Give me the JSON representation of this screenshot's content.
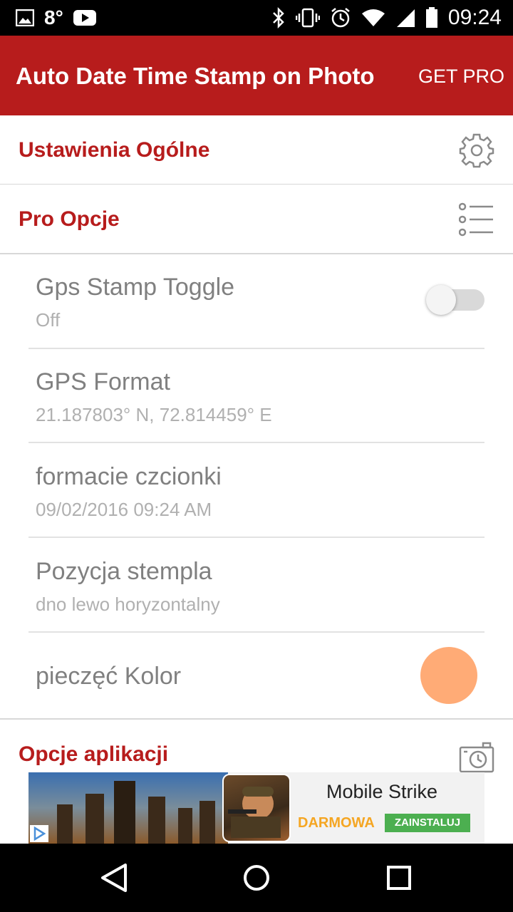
{
  "status_bar": {
    "temperature": "8°",
    "time": "09:24",
    "left_icons": [
      "image-icon",
      "youtube-icon"
    ],
    "right_icons": [
      "bluetooth-icon",
      "vibrate-icon",
      "alarm-icon",
      "wifi-icon",
      "signal-icon",
      "battery-icon"
    ]
  },
  "app_bar": {
    "title": "Auto Date Time Stamp on Photo",
    "action": "GET PRO",
    "color": "#b71c1c"
  },
  "sections": {
    "general": {
      "title": "Ustawienia Ogólne",
      "icon": "gear-icon"
    },
    "pro": {
      "title": "Pro Opcje",
      "icon": "list-icon"
    },
    "app": {
      "title": "Opcje aplikacji",
      "icon": "camera-clock-icon"
    }
  },
  "prefs": {
    "gps_toggle": {
      "title": "Gps Stamp Toggle",
      "summary": "Off",
      "enabled": false
    },
    "gps_format": {
      "title": "GPS Format",
      "summary": "21.187803° N, 72.814459° E"
    },
    "font_format": {
      "title": "formacie czcionki",
      "summary": "09/02/2016 09:24 AM"
    },
    "stamp_position": {
      "title": "Pozycja stempla",
      "summary": "dno lewo horyzontalny"
    },
    "stamp_color": {
      "title": "pieczęć Kolor",
      "color": "#ffab76"
    }
  },
  "ad": {
    "title": "Mobile Strike",
    "free_label": "DARMOWA",
    "install_label": "ZAINSTALUJ"
  },
  "nav_bar": {
    "icons": [
      "back-icon",
      "home-icon",
      "recents-icon"
    ]
  }
}
